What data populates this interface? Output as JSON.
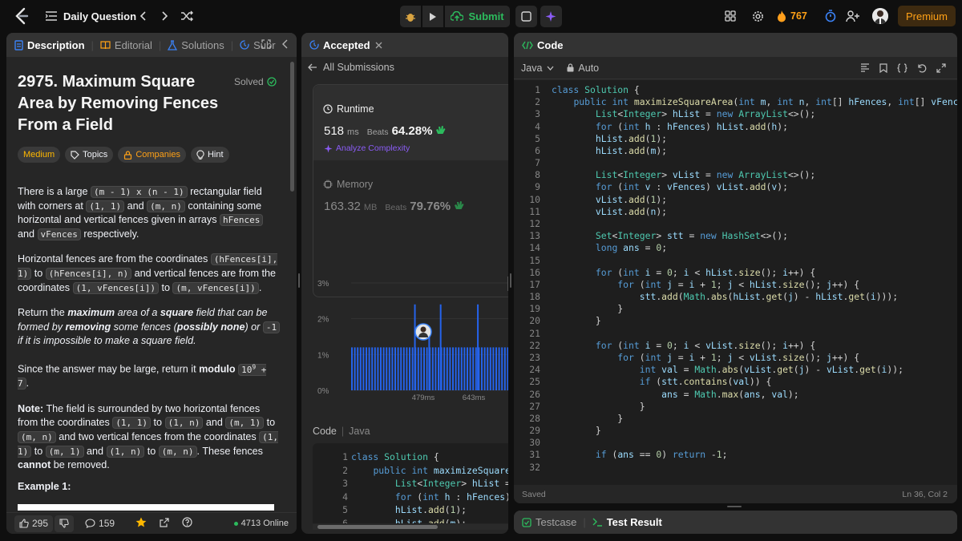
{
  "topbar": {
    "title": "Daily Question",
    "submit": "Submit",
    "streak": "767",
    "premium": "Premium"
  },
  "left": {
    "tabs": [
      "Description",
      "Editorial",
      "Solutions",
      "Subr"
    ],
    "problem_title": "2975. Maximum Square Area by Removing Fences From a Field",
    "title_lines": [
      "2975. Maximum Square",
      "Area by Removing Fences",
      "From a Field"
    ],
    "solved": "Solved",
    "tags": [
      "Medium",
      "Topics",
      "Companies",
      "Hint"
    ],
    "p1": {
      "a": "There is a large ",
      "c1": "(m - 1) x (n - 1)",
      "b": " rectangular field with corners at ",
      "c2": "(1, 1)",
      "c": " and ",
      "c3": "(m, n)",
      "d": " containing some horizontal and vertical fences given in arrays ",
      "c4": "hFences",
      "e": " and ",
      "c5": "vFences",
      "f": " respectively."
    },
    "p2": {
      "a": "Horizontal fences are from the coordinates ",
      "c1": "(hFences[i], 1)",
      "b": " to ",
      "c2": "(hFences[i], n)",
      "c": " and vertical fences are from the coordinates ",
      "c3": "(1, vFences[i])",
      "d": " to ",
      "c4": "(m, vFences[i])",
      "e": "."
    },
    "p3": {
      "a": "Return the ",
      "b": "maximum",
      "c": " area of a ",
      "d": "square",
      "e": " field that can be formed by ",
      "f": "removing",
      "g": " some fences (",
      "h": "possibly none",
      "i": ") or ",
      "c1": "-1",
      "j": " if it is impossible to make a square field."
    },
    "p4": {
      "a": "Since the answer may be large, return it ",
      "b": "modulo",
      "c1": "10",
      "sup": "9",
      "c2": " + 7",
      "d": "."
    },
    "p5": {
      "a": "Note:",
      "b": " The field is surrounded by two horizontal fences from the coordinates ",
      "c1": "(1, 1)",
      "c": " to ",
      "c2": "(1, n)",
      "d": " and ",
      "c3": "(m, 1)",
      "e": " to ",
      "c4": "(m, n)",
      "f": " and two vertical fences from the coordinates ",
      "c5": "(1, 1)",
      "g": " to ",
      "c6": "(m, 1)",
      "h": " and ",
      "c7": "(1, n)",
      "i": " to ",
      "c8": "(m, n)",
      "j": ". These fences ",
      "k": "cannot",
      "l": " be removed."
    },
    "example": "Example 1:",
    "footer": {
      "likes": "295",
      "comments": "159",
      "online": "4713 Online"
    }
  },
  "middle": {
    "tab": "Accepted",
    "back": "All Submissions",
    "runtime_label": "Runtime",
    "runtime_value": "518",
    "runtime_unit": "ms",
    "beats_label": "Beats",
    "runtime_beats": "64.28%",
    "analyze": "Analyze Complexity",
    "memory_label": "Memory",
    "memory_value": "163.32",
    "memory_unit": "MB",
    "memory_beats": "79.76%",
    "code_label": "Code",
    "lang": "Java",
    "code_lines": [
      {
        "n": "1",
        "t": "class Solution {"
      },
      {
        "n": "2",
        "t": "    public int maximizeSquareA"
      },
      {
        "n": "3",
        "t": "        List<Integer> hList ="
      },
      {
        "n": "4",
        "t": "        for (int h : hFences)"
      },
      {
        "n": "5",
        "t": "        hList.add(1);"
      },
      {
        "n": "6",
        "t": "        hList.add(m);"
      }
    ]
  },
  "chart_data": {
    "type": "bar",
    "title": "",
    "xlabel": "",
    "ylabel": "",
    "ylim": [
      0,
      3
    ],
    "y_ticks": [
      "3%",
      "2%",
      "1%",
      "0%"
    ],
    "x_ticks": [
      "479ms",
      "643ms"
    ],
    "x_range_ms": [
      420,
      700
    ],
    "series": [
      {
        "values_note": "dense distribution ~1% baseline",
        "baseline": 1.2,
        "spikes": [
          {
            "x": 530,
            "y": 2.4
          },
          {
            "x": 575,
            "y": 2.4
          },
          {
            "x": 640,
            "y": 2.4
          },
          {
            "x": 555,
            "y": 1.65
          }
        ]
      }
    ],
    "colors": {
      "bars": "#2563eb"
    }
  },
  "right": {
    "tab": "Code",
    "lang": "Java",
    "mode": "Auto",
    "status": "Saved",
    "cursor": "Ln 36, Col 2",
    "bottom_tabs": [
      "Testcase",
      "Test Result"
    ],
    "code_lines": [
      {
        "n": "1",
        "t": "class Solution {"
      },
      {
        "n": "2",
        "t": "    public int maximizeSquareArea(int m, int n, int[] hFences, int[] vFences) {"
      },
      {
        "n": "3",
        "t": "        List<Integer> hList = new ArrayList<>();"
      },
      {
        "n": "4",
        "t": "        for (int h : hFences) hList.add(h);"
      },
      {
        "n": "5",
        "t": "        hList.add(1);"
      },
      {
        "n": "6",
        "t": "        hList.add(m);"
      },
      {
        "n": "7",
        "t": ""
      },
      {
        "n": "8",
        "t": "        List<Integer> vList = new ArrayList<>();"
      },
      {
        "n": "9",
        "t": "        for (int v : vFences) vList.add(v);"
      },
      {
        "n": "10",
        "t": "        vList.add(1);"
      },
      {
        "n": "11",
        "t": "        vList.add(n);"
      },
      {
        "n": "12",
        "t": ""
      },
      {
        "n": "13",
        "t": "        Set<Integer> stt = new HashSet<>();"
      },
      {
        "n": "14",
        "t": "        long ans = 0;"
      },
      {
        "n": "15",
        "t": ""
      },
      {
        "n": "16",
        "t": "        for (int i = 0; i < hList.size(); i++) {"
      },
      {
        "n": "17",
        "t": "            for (int j = i + 1; j < hList.size(); j++) {"
      },
      {
        "n": "18",
        "t": "                stt.add(Math.abs(hList.get(j) - hList.get(i)));"
      },
      {
        "n": "19",
        "t": "            }"
      },
      {
        "n": "20",
        "t": "        }"
      },
      {
        "n": "21",
        "t": ""
      },
      {
        "n": "22",
        "t": "        for (int i = 0; i < vList.size(); i++) {"
      },
      {
        "n": "23",
        "t": "            for (int j = i + 1; j < vList.size(); j++) {"
      },
      {
        "n": "24",
        "t": "                int val = Math.abs(vList.get(j) - vList.get(i));"
      },
      {
        "n": "25",
        "t": "                if (stt.contains(val)) {"
      },
      {
        "n": "26",
        "t": "                    ans = Math.max(ans, val);"
      },
      {
        "n": "27",
        "t": "                }"
      },
      {
        "n": "28",
        "t": "            }"
      },
      {
        "n": "29",
        "t": "        }"
      },
      {
        "n": "30",
        "t": ""
      },
      {
        "n": "31",
        "t": "        if (ans == 0) return -1;"
      },
      {
        "n": "32",
        "t": ""
      }
    ]
  }
}
